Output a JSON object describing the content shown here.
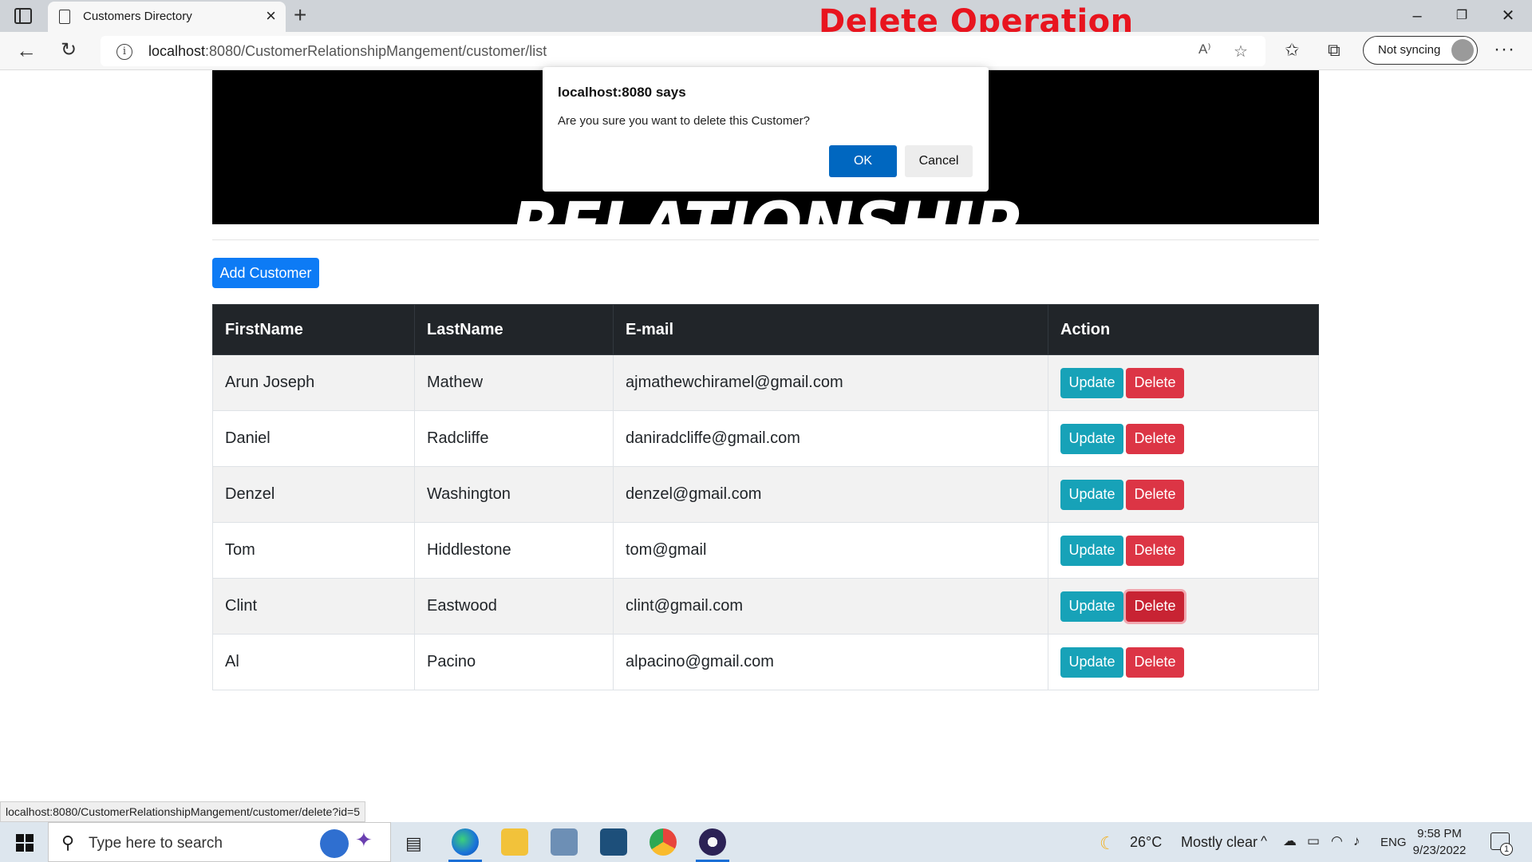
{
  "browser": {
    "tab_title": "Customers Directory",
    "url_host": "localhost",
    "url_rest": ":8080/CustomerRelationshipMangement/customer/list",
    "sync_label": "Not syncing",
    "overlay_heading": "Delete Operation"
  },
  "page": {
    "banner_title": "CUSTOMER RELATIONSHIP MANAGEMENT",
    "add_button": "Add Customer",
    "table": {
      "headers": [
        "FirstName",
        "LastName",
        "E-mail",
        "Action"
      ],
      "rows": [
        {
          "first": "Arun Joseph",
          "last": "Mathew",
          "email": "ajmathewchiramel@gmail.com"
        },
        {
          "first": "Daniel",
          "last": "Radcliffe",
          "email": "daniradcliffe@gmail.com"
        },
        {
          "first": "Denzel",
          "last": "Washington",
          "email": "denzel@gmail.com"
        },
        {
          "first": "Tom",
          "last": "Hiddlestone",
          "email": "tom@gmail"
        },
        {
          "first": "Clint",
          "last": "Eastwood",
          "email": "clint@gmail.com"
        },
        {
          "first": "Al",
          "last": "Pacino",
          "email": "alpacino@gmail.com"
        }
      ],
      "update_label": "Update",
      "delete_label": "Delete"
    }
  },
  "dialog": {
    "title": "localhost:8080 says",
    "message": "Are you sure you want to delete this Customer?",
    "ok_label": "OK",
    "cancel_label": "Cancel"
  },
  "status_bar": {
    "link": "localhost:8080/CustomerRelationshipMangement/customer/delete?id=5"
  },
  "taskbar": {
    "search_placeholder": "Type here to search",
    "weather_temp": "26°C",
    "weather_desc": "Mostly clear",
    "language": "ENG",
    "time": "9:58 PM",
    "date": "9/23/2022",
    "notification_count": "1"
  },
  "colors": {
    "primary": "#0d7bf5",
    "update": "#17a2b8",
    "delete": "#dc3545",
    "table_header": "#212529",
    "overlay_heading": "#e8141e",
    "dialog_ok": "#0067c0"
  }
}
